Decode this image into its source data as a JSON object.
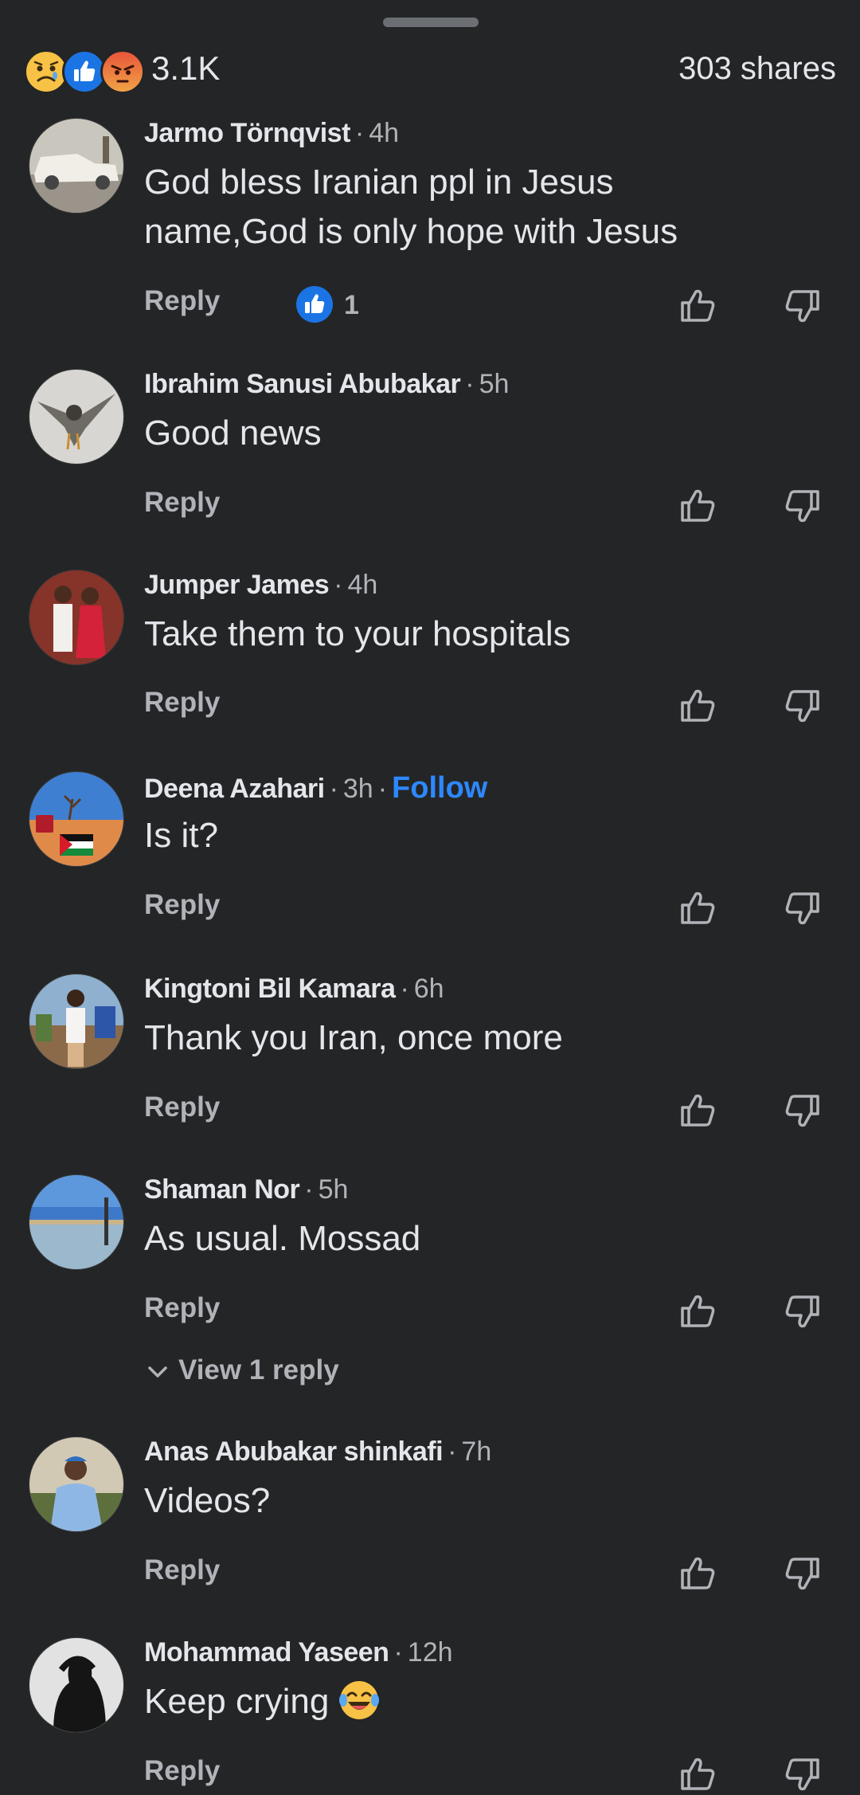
{
  "summary": {
    "reaction_icons": [
      "sad-reaction-icon",
      "like-reaction-icon",
      "angry-reaction-icon"
    ],
    "reaction_count": "3.1K",
    "shares": "303 shares"
  },
  "labels": {
    "reply": "Reply",
    "follow": "Follow",
    "dot": "·"
  },
  "comments": [
    {
      "author": "Jarmo Törnqvist",
      "time": "4h",
      "text_lines": [
        "God bless Iranian ppl in Jesus",
        "name,God is only hope with Jesus"
      ],
      "like_count": "1"
    },
    {
      "author": "Ibrahim Sanusi Abubakar",
      "time": "5h",
      "text": "Good news"
    },
    {
      "author": "Jumper James",
      "time": "4h",
      "text": "Take them to your hospitals"
    },
    {
      "author": "Deena Azahari",
      "time": "3h",
      "text": "Is it?",
      "show_follow": true
    },
    {
      "author": "Kingtoni Bil Kamara",
      "time": "6h",
      "text": "Thank you Iran, once more"
    },
    {
      "author": "Shaman Nor",
      "time": "5h",
      "text": "As usual. Mossad",
      "view_replies": "View 1 reply"
    },
    {
      "author": "Anas Abubakar shinkafi",
      "time": "7h",
      "text": "Videos?"
    },
    {
      "author": "Mohammad Yaseen",
      "time": "12h",
      "text": "Keep crying",
      "emoji": "laughing-tears-emoji"
    }
  ],
  "colors": {
    "background": "#242526",
    "text": "#e4e6eb",
    "muted": "#b0b3b8",
    "accent": "#2d88ff",
    "like_blue": "#1b74e4"
  }
}
